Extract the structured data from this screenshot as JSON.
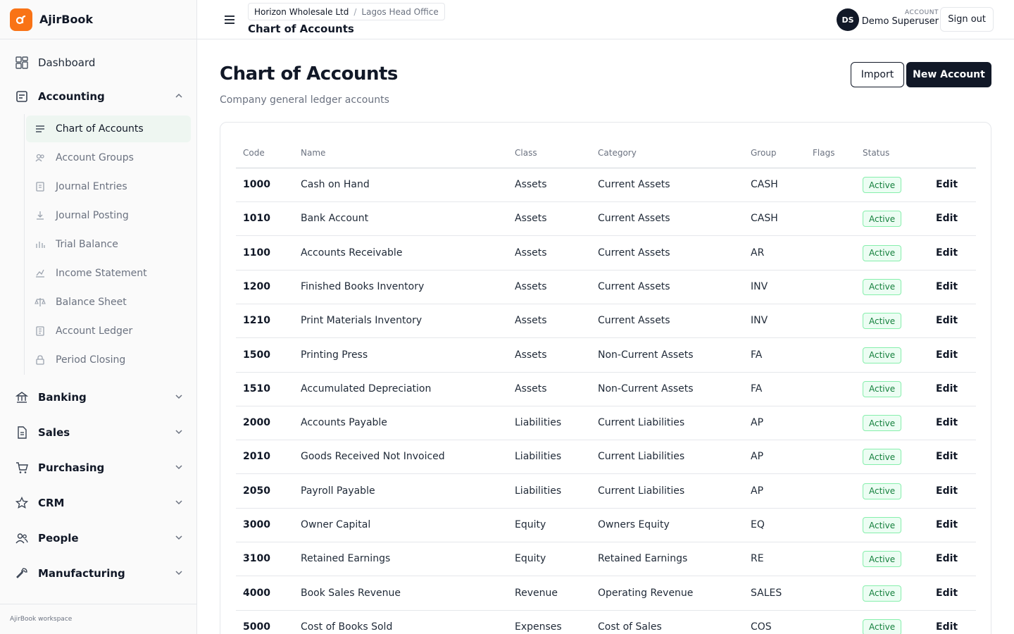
{
  "app": {
    "name": "AjirBook",
    "logo_glyph": "ᵅ",
    "workspace": "AjirBook workspace"
  },
  "sidebar": {
    "dashboard": "Dashboard",
    "accounting": {
      "label": "Accounting",
      "items": [
        {
          "label": "Chart of Accounts",
          "icon": "list-icon",
          "active": true
        },
        {
          "label": "Account Groups",
          "icon": "group-icon"
        },
        {
          "label": "Journal Entries",
          "icon": "document-icon"
        },
        {
          "label": "Journal Posting",
          "icon": "download-icon"
        },
        {
          "label": "Trial Balance",
          "icon": "bar-chart-icon"
        },
        {
          "label": "Income Statement",
          "icon": "line-chart-icon"
        },
        {
          "label": "Balance Sheet",
          "icon": "scale-icon"
        },
        {
          "label": "Account Ledger",
          "icon": "ledger-icon"
        },
        {
          "label": "Period Closing",
          "icon": "lock-icon"
        }
      ]
    },
    "groups": [
      {
        "label": "Banking",
        "icon": "bank-icon"
      },
      {
        "label": "Sales",
        "icon": "receipt-icon"
      },
      {
        "label": "Purchasing",
        "icon": "cart-icon"
      },
      {
        "label": "CRM",
        "icon": "star-icon"
      },
      {
        "label": "People",
        "icon": "people-icon"
      },
      {
        "label": "Manufacturing",
        "icon": "wrench-icon"
      }
    ]
  },
  "topbar": {
    "breadcrumb": {
      "company": "Horizon Wholesale Ltd",
      "separator": "/",
      "branch": "Lagos Head Office"
    },
    "title": "Chart of Accounts",
    "avatar_initials": "DS",
    "account_label": "ACCOUNT",
    "account_name": "Demo Superuser",
    "sign_out": "Sign out"
  },
  "page": {
    "title": "Chart of Accounts",
    "subtitle": "Company general ledger accounts",
    "import_label": "Import",
    "new_label": "New Account"
  },
  "table": {
    "headers": {
      "code": "Code",
      "name": "Name",
      "class": "Class",
      "category": "Category",
      "group": "Group",
      "flags": "Flags",
      "status": "Status"
    },
    "edit_label": "Edit",
    "rows": [
      {
        "code": "1000",
        "name": "Cash on Hand",
        "class": "Assets",
        "category": "Current Assets",
        "group": "CASH",
        "flags": "",
        "status": "Active"
      },
      {
        "code": "1010",
        "name": "Bank Account",
        "class": "Assets",
        "category": "Current Assets",
        "group": "CASH",
        "flags": "",
        "status": "Active"
      },
      {
        "code": "1100",
        "name": "Accounts Receivable",
        "class": "Assets",
        "category": "Current Assets",
        "group": "AR",
        "flags": "",
        "status": "Active"
      },
      {
        "code": "1200",
        "name": "Finished Books Inventory",
        "class": "Assets",
        "category": "Current Assets",
        "group": "INV",
        "flags": "",
        "status": "Active"
      },
      {
        "code": "1210",
        "name": "Print Materials Inventory",
        "class": "Assets",
        "category": "Current Assets",
        "group": "INV",
        "flags": "",
        "status": "Active"
      },
      {
        "code": "1500",
        "name": "Printing Press",
        "class": "Assets",
        "category": "Non-Current Assets",
        "group": "FA",
        "flags": "",
        "status": "Active"
      },
      {
        "code": "1510",
        "name": "Accumulated Depreciation",
        "class": "Assets",
        "category": "Non-Current Assets",
        "group": "FA",
        "flags": "",
        "status": "Active"
      },
      {
        "code": "2000",
        "name": "Accounts Payable",
        "class": "Liabilities",
        "category": "Current Liabilities",
        "group": "AP",
        "flags": "",
        "status": "Active"
      },
      {
        "code": "2010",
        "name": "Goods Received Not Invoiced",
        "class": "Liabilities",
        "category": "Current Liabilities",
        "group": "AP",
        "flags": "",
        "status": "Active"
      },
      {
        "code": "2050",
        "name": "Payroll Payable",
        "class": "Liabilities",
        "category": "Current Liabilities",
        "group": "AP",
        "flags": "",
        "status": "Active"
      },
      {
        "code": "3000",
        "name": "Owner Capital",
        "class": "Equity",
        "category": "Owners Equity",
        "group": "EQ",
        "flags": "",
        "status": "Active"
      },
      {
        "code": "3100",
        "name": "Retained Earnings",
        "class": "Equity",
        "category": "Retained Earnings",
        "group": "RE",
        "flags": "",
        "status": "Active"
      },
      {
        "code": "4000",
        "name": "Book Sales Revenue",
        "class": "Revenue",
        "category": "Operating Revenue",
        "group": "SALES",
        "flags": "",
        "status": "Active"
      },
      {
        "code": "5000",
        "name": "Cost of Books Sold",
        "class": "Expenses",
        "category": "Cost of Sales",
        "group": "COS",
        "flags": "",
        "status": "Active"
      }
    ]
  }
}
